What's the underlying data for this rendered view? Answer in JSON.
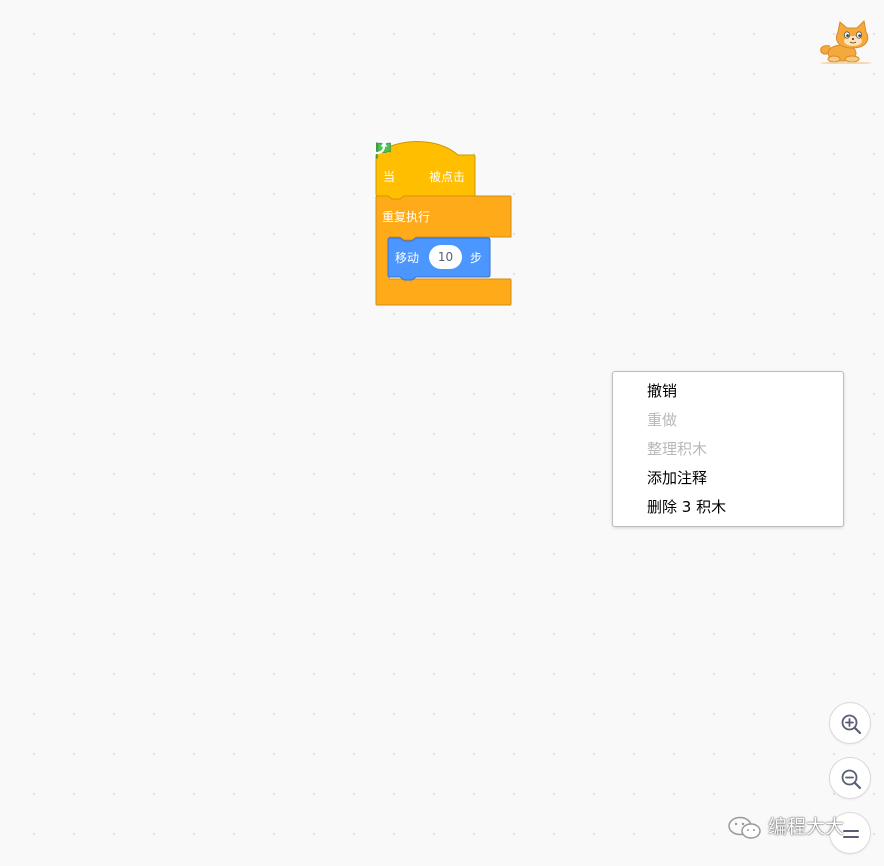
{
  "colors": {
    "events": "#ffbf00",
    "control": "#ffab19",
    "motion": "#4c97ff",
    "flag": "#4cbf56"
  },
  "script": {
    "hat": {
      "when_label": "当",
      "flag_icon": "green-flag-icon",
      "clicked_label": "被点击"
    },
    "forever": {
      "label": "重复执行",
      "loop_icon": "loop-arrow-icon"
    },
    "move": {
      "label": "移动",
      "value": "10",
      "steps_label": "步"
    }
  },
  "context_menu": {
    "items": [
      {
        "label": "撤销",
        "enabled": true
      },
      {
        "label": "重做",
        "enabled": false
      },
      {
        "label": "整理积木",
        "enabled": false
      },
      {
        "label": "添加注释",
        "enabled": true
      },
      {
        "label": "删除 3 积木",
        "enabled": true
      }
    ]
  },
  "zoom_controls": {
    "zoom_in_icon": "zoom-in-icon",
    "zoom_out_icon": "zoom-out-icon",
    "reset_icon": "zoom-reset-icon"
  },
  "sprite": {
    "icon": "cat-sprite-icon"
  },
  "watermark": {
    "icon": "wechat-icon",
    "text": "编程大大"
  }
}
